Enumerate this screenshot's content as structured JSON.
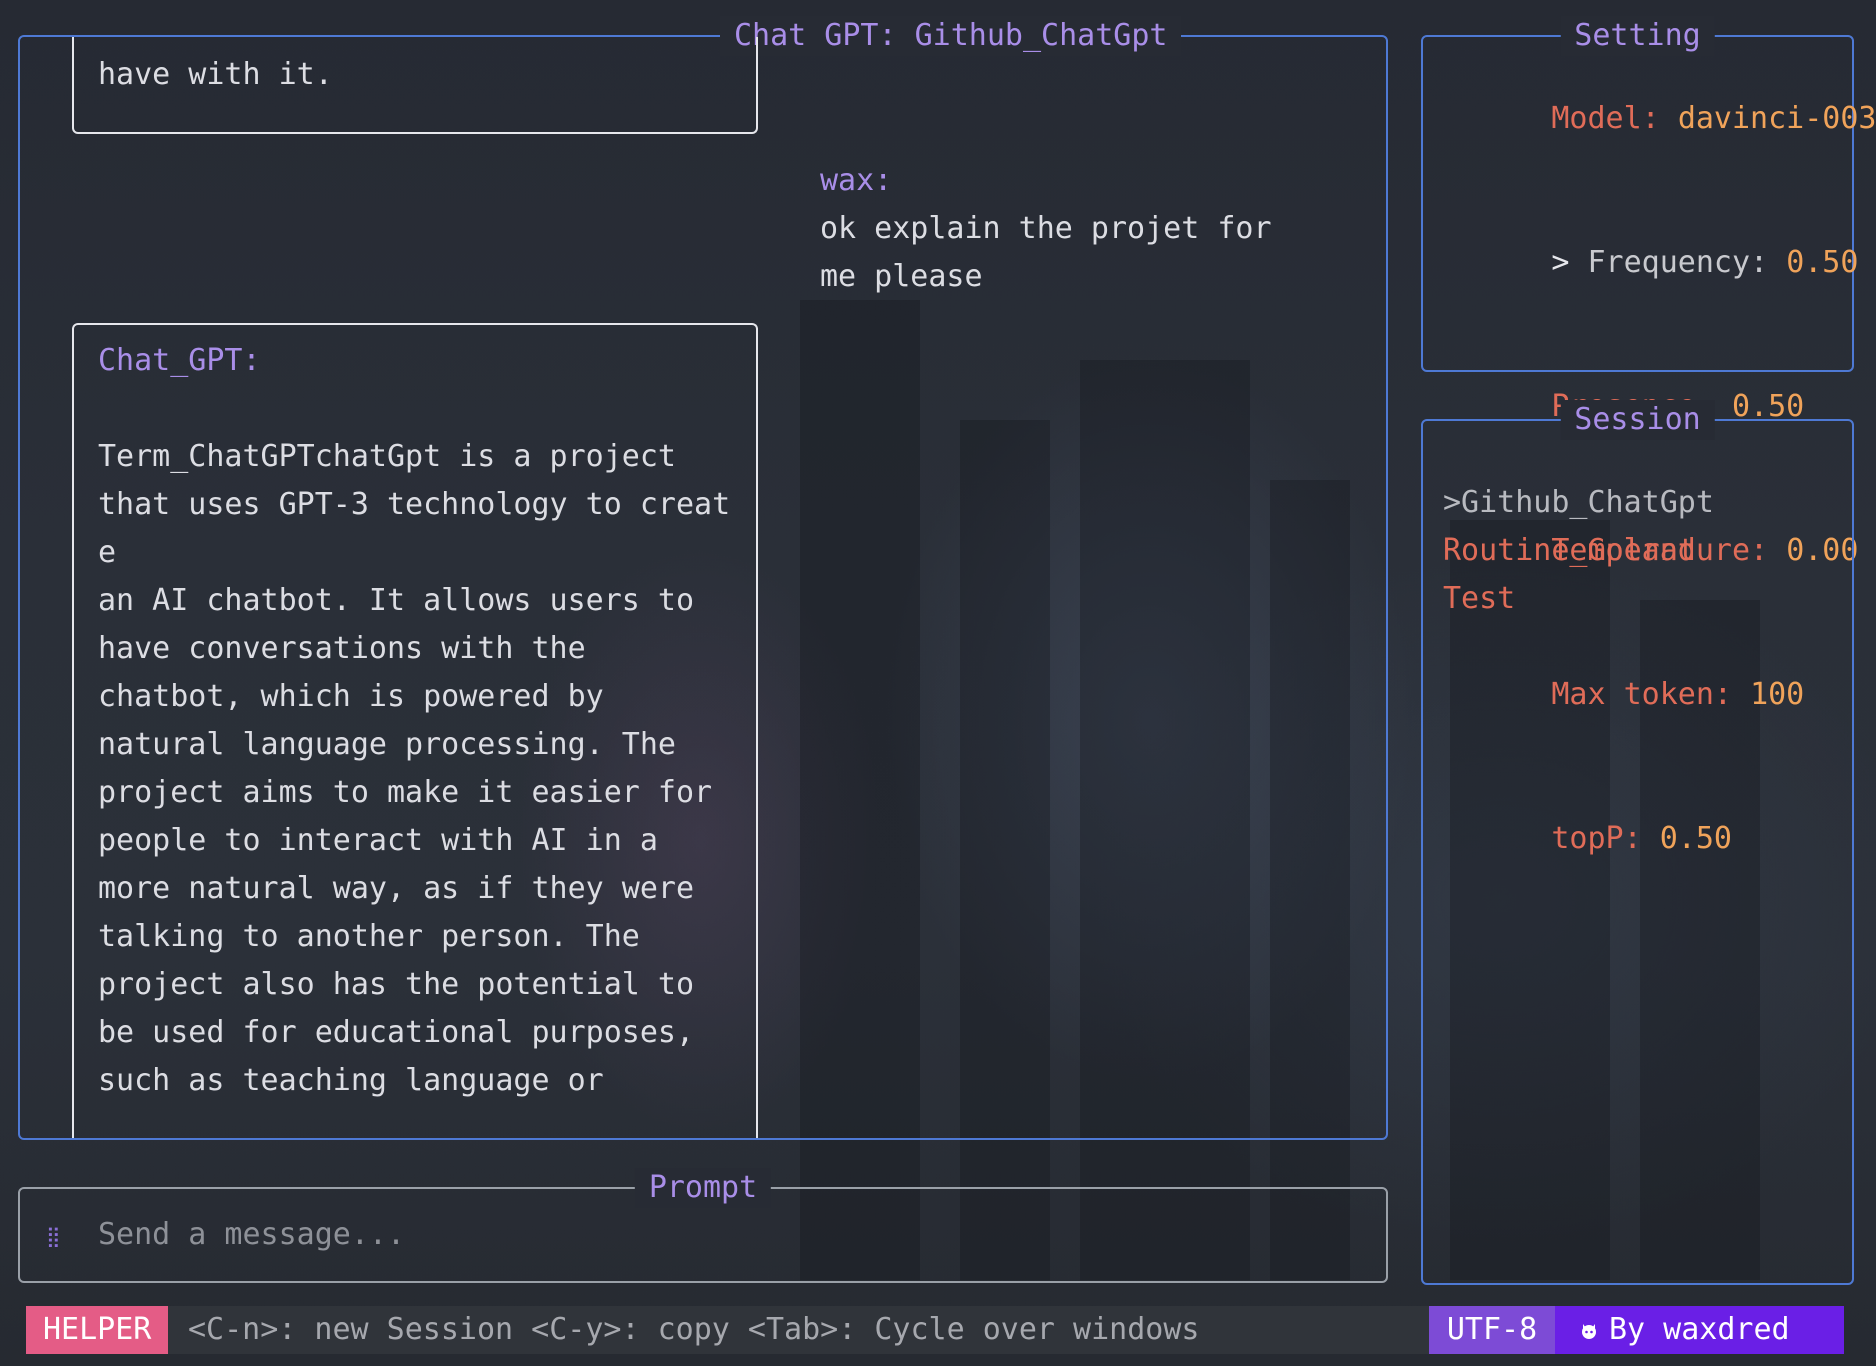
{
  "chat": {
    "title": "Chat GPT: Github_ChatGpt",
    "top_bubble_lines": [
      "have with it."
    ],
    "user": {
      "speaker": "wax:",
      "lines": [
        "ok explain the projet for",
        "me please"
      ]
    },
    "assistant": {
      "speaker": "Chat_GPT:",
      "lines": [
        "Term_ChatGPTchatGpt is a project",
        "that uses GPT-3 technology to creat",
        "e",
        "an AI chatbot. It allows users to",
        "have conversations with the",
        "chatbot, which is powered by",
        "natural language processing. The",
        "project aims to make it easier for",
        "people to interact with AI in a",
        "more natural way, as if they were",
        "talking to another person. The",
        "project also has the potential to",
        "be used for educational purposes,",
        "such as teaching language or"
      ]
    }
  },
  "setting": {
    "title": "Setting",
    "model_label": "Model: ",
    "model_value": "davinci-003",
    "selected_marker": "> ",
    "frequency_label": "Frequency: ",
    "frequency_value": "0.50",
    "presence_label": "Presence: ",
    "presence_value": "0.50",
    "temperature_label": "Temperature: ",
    "temperature_value": "0.00",
    "max_token_label": "Max token: ",
    "max_token_value": "100",
    "topp_label": "topP: ",
    "topp_value": "0.50"
  },
  "session": {
    "title": "Session",
    "active": ">Github_ChatGpt",
    "items": [
      "Routine_Goland",
      "Test"
    ]
  },
  "prompt": {
    "title": "Prompt",
    "placeholder": "Send a message...",
    "icon": "drag-handle-icon"
  },
  "status_bar": {
    "helper_label": "HELPER",
    "helper_text": "<C-n>: new Session <C-y>: copy <Tab>: Cycle over windows",
    "encoding": "UTF-8",
    "author": "By waxdred",
    "author_icon": "github-icon"
  },
  "colors": {
    "border_accent": "#4e79d4",
    "title_purple": "#a98ee8",
    "key_red": "#e06c58",
    "value_orange": "#f0a35a",
    "helper_pink": "#e45c86",
    "encoding_purple": "#7d4bd6",
    "author_violet": "#6a1fe6"
  }
}
